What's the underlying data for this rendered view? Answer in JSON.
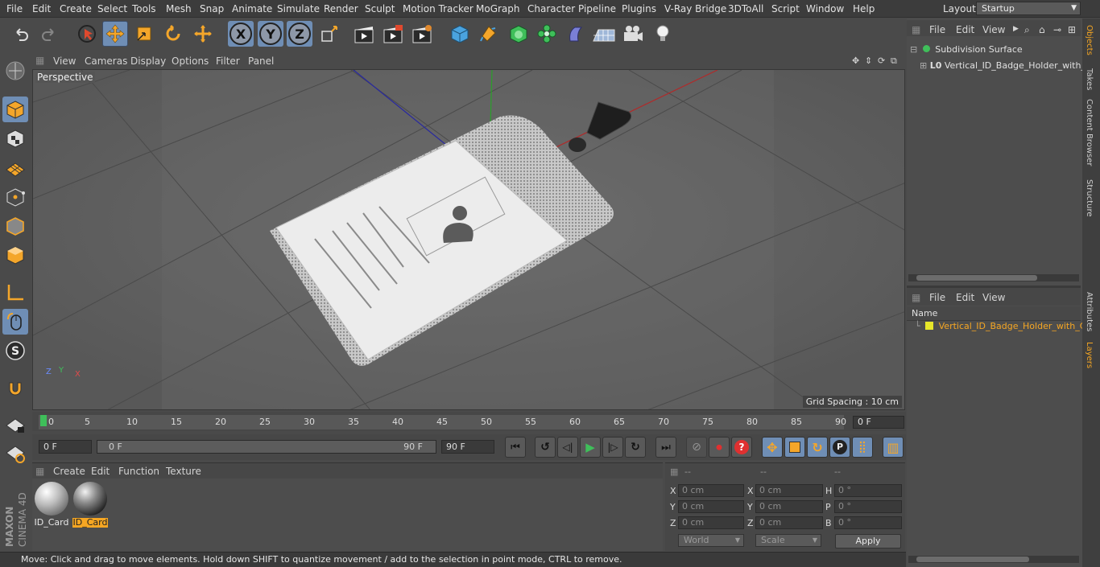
{
  "menu": [
    "File",
    "Edit",
    "Create",
    "Select",
    "Tools",
    "Mesh",
    "Snap",
    "Animate",
    "Simulate",
    "Render",
    "Sculpt",
    "Motion Tracker",
    "MoGraph",
    "Character",
    "Pipeline",
    "Plugins",
    "V-Ray Bridge",
    "3DToAll",
    "Script",
    "Window",
    "Help"
  ],
  "layout": {
    "label": "Layout:",
    "value": "Startup"
  },
  "toolbar": {
    "x": "X",
    "y": "Y",
    "z": "Z"
  },
  "viewport_menu": [
    "View",
    "Cameras",
    "Display",
    "Options",
    "Filter",
    "Panel"
  ],
  "viewport": {
    "name": "Perspective",
    "grid_spacing": "Grid Spacing : 10 cm",
    "axis_x": "X",
    "axis_y": "Y",
    "axis_z": "Z"
  },
  "timeline": {
    "ticks": [
      "0",
      "5",
      "10",
      "15",
      "20",
      "25",
      "30",
      "35",
      "40",
      "45",
      "50",
      "55",
      "60",
      "65",
      "70",
      "75",
      "80",
      "85",
      "90"
    ],
    "current": "0 F"
  },
  "transport": {
    "start": "0 F",
    "range_start": "0 F",
    "range_end": "90 F",
    "end": "90 F"
  },
  "material_menu": [
    "Create",
    "Edit",
    "Function",
    "Texture"
  ],
  "materials": [
    {
      "name": "ID_Card",
      "selected": false
    },
    {
      "name": "ID_Card",
      "selected": true
    }
  ],
  "coords": {
    "headers": [
      "--",
      "--",
      "--"
    ],
    "rows": [
      {
        "a": "X",
        "av": "0 cm",
        "b": "X",
        "bv": "0 cm",
        "c": "H",
        "cv": "0 °"
      },
      {
        "a": "Y",
        "av": "0 cm",
        "b": "Y",
        "bv": "0 cm",
        "c": "P",
        "cv": "0 °"
      },
      {
        "a": "Z",
        "av": "0 cm",
        "b": "Z",
        "bv": "0 cm",
        "c": "B",
        "cv": "0 °"
      }
    ],
    "world": "World",
    "scale": "Scale",
    "apply": "Apply"
  },
  "status": "Move: Click and drag to move elements. Hold down SHIFT to quantize movement / add to the selection in point mode, CTRL to remove.",
  "object_menu": [
    "File",
    "Edit",
    "View"
  ],
  "objects": [
    {
      "name": "Subdivision Surface"
    },
    {
      "name": "Vertical_ID_Badge_Holder_with_C"
    }
  ],
  "layer_menu": [
    "File",
    "Edit",
    "View"
  ],
  "layers": {
    "header": "Name",
    "item": "Vertical_ID_Badge_Holder_with_Cl"
  },
  "side_tabs": [
    "Objects",
    "Takes",
    "Content Browser",
    "Structure",
    "Attributes",
    "Layers"
  ],
  "brand": {
    "line1": "MAXON",
    "line2": "CINEMA 4D"
  }
}
